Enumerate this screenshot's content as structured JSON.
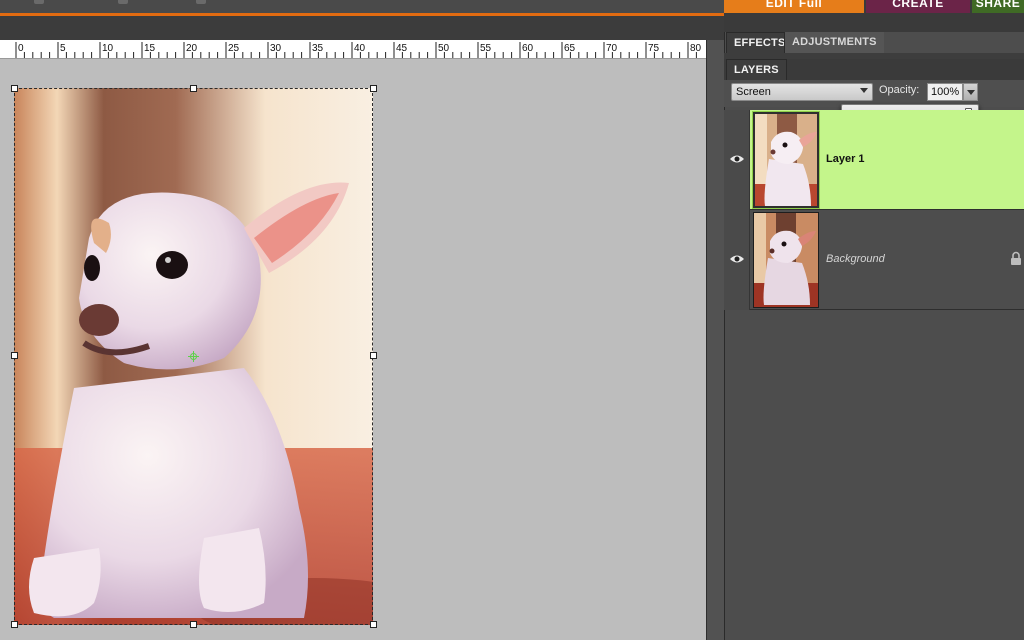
{
  "modes": {
    "edit": "EDIT Full",
    "create": "CREATE",
    "share": "SHARE"
  },
  "ruler": {
    "labels": [
      "0",
      "5",
      "10",
      "15",
      "20",
      "25",
      "30",
      "35",
      "40",
      "45",
      "50",
      "55",
      "60",
      "65",
      "70",
      "75",
      "80"
    ]
  },
  "panel": {
    "tabs": {
      "effects": "EFFECTS",
      "adjustments": "ADJUSTMENTS",
      "layers": "LAYERS"
    },
    "blend_mode": "Screen",
    "opacity_label": "Opacity:",
    "opacity_value": "100%",
    "opacity_fraction": 1.0
  },
  "layers": [
    {
      "name": "Layer 1",
      "selected": true,
      "visible": true,
      "locked": false
    },
    {
      "name": "Background",
      "selected": false,
      "visible": true,
      "locked": true
    }
  ],
  "colors": {
    "accent_orange": "#e26b10",
    "selected_layer": "#c4f58b",
    "create_tab": "#6b2448",
    "share_tab": "#3f6a25"
  },
  "icons": [
    "eye-icon",
    "lock-icon",
    "chevron-down-icon",
    "transform-pivot-icon"
  ]
}
